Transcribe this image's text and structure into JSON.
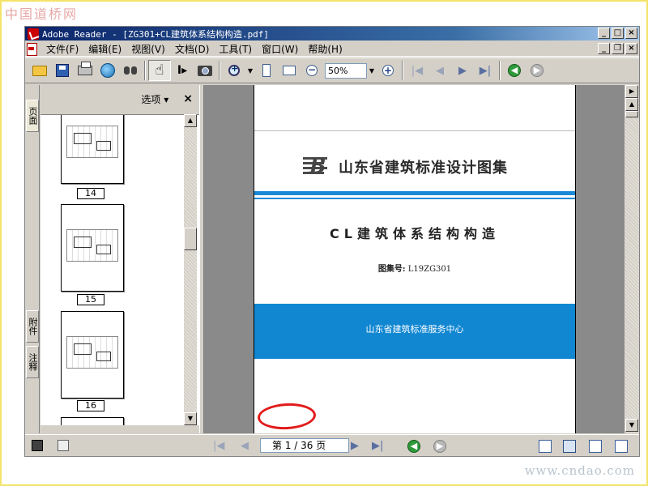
{
  "watermark": {
    "top": "中国道桥网",
    "bottom": "www.cndao.com"
  },
  "window": {
    "title": "Adobe Reader - [ZG301+CL建筑体系结构构造.pdf]"
  },
  "menu": [
    {
      "label": "文件(F)"
    },
    {
      "label": "编辑(E)"
    },
    {
      "label": "视图(V)"
    },
    {
      "label": "文档(D)"
    },
    {
      "label": "工具(T)"
    },
    {
      "label": "窗口(W)"
    },
    {
      "label": "帮助(H)"
    }
  ],
  "toolbar": {
    "zoom_value": "50%"
  },
  "left_tabs": {
    "pages": "页面",
    "attachments": "附件",
    "comments": "注释"
  },
  "panel": {
    "options_label": "选项",
    "options_arrow": "▾",
    "close_label": "×",
    "thumbnails": [
      {
        "label": "14"
      },
      {
        "label": "15"
      },
      {
        "label": "16"
      }
    ]
  },
  "document": {
    "org_name": "山东省建筑标准设计图集",
    "title": "CL建筑体系结构构造",
    "atlas_label": "图集号:",
    "atlas_number": "L19ZG301",
    "publisher": "山东省建筑标准服务中心"
  },
  "statusbar": {
    "page_indicator": "第 1 / 36 页"
  },
  "colors": {
    "accent_blue": "#1187d2",
    "title_bar": "#0a246a",
    "highlight_ring": "#e21b1b"
  }
}
